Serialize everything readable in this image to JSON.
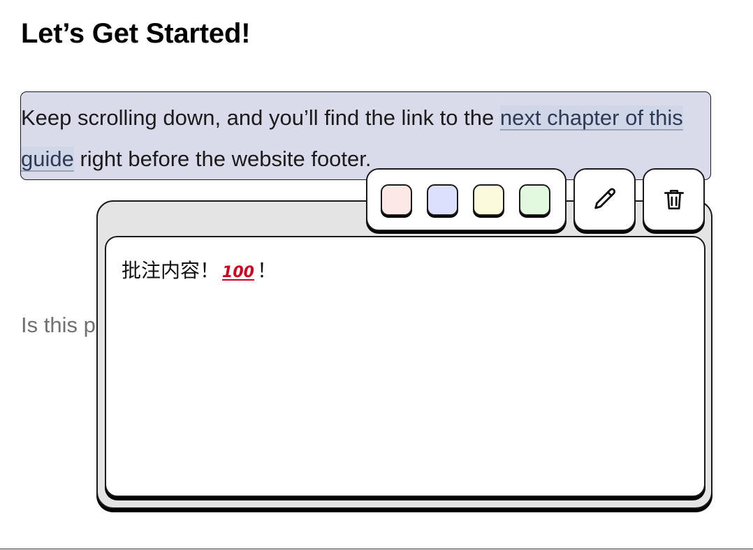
{
  "heading": "Let’s Get Started!",
  "paragraph": {
    "before": "Keep scrolling down, and you’ll find the link to the ",
    "link": "next chapter of this guide",
    "after": " right before the website footer."
  },
  "faded_text": "Is this p",
  "annotation": {
    "text_before": "批注内容！",
    "emoji": "100",
    "text_after": "！"
  },
  "toolbar": {
    "colors": [
      {
        "name": "pink",
        "hex": "#fde8e8"
      },
      {
        "name": "blue",
        "hex": "#dde0fc"
      },
      {
        "name": "yellow",
        "hex": "#fbfadc"
      },
      {
        "name": "green",
        "hex": "#e2f8df"
      }
    ],
    "edit_icon": "pencil-icon",
    "delete_icon": "trash-icon"
  }
}
